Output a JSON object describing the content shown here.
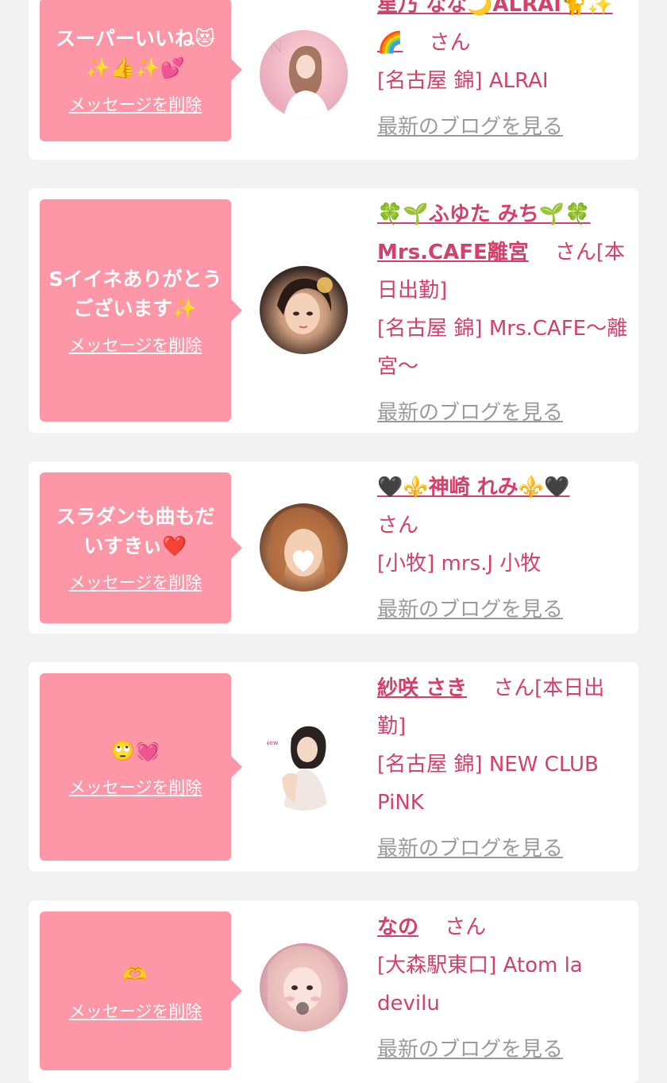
{
  "messages": [
    {
      "bubble": "スーパーいいね😻✨👍✨💕",
      "delete": "メッセージを削除",
      "name": "星乃 なな🌙ALRAI🐈✨🌈",
      "honorific": "さん",
      "status": "",
      "shop": "[名古屋 錦] ALRAI",
      "blog": "最新のブログを見る"
    },
    {
      "bubble": "Sイイネありがとうございます✨",
      "delete": "メッセージを削除",
      "name": "🍀🌱ふゆた みち🌱🍀Mrs.CAFE離宮",
      "honorific": "さん",
      "status": "[本日出勤]",
      "shop": "[名古屋 錦] Mrs.CAFE～離宮～",
      "blog": "最新のブログを見る"
    },
    {
      "bubble": "スラダンも曲もだいすきぃ❤️",
      "delete": "メッセージを削除",
      "name": "🖤⚜️神崎 れみ⚜️🖤",
      "honorific": "さん",
      "status": "",
      "shop": "[小牧] mrs.J 小牧",
      "blog": "最新のブログを見る"
    },
    {
      "bubble": "🙄💓",
      "delete": "メッセージを削除",
      "name": "紗咲 さき",
      "honorific": "さん",
      "status": "[本日出勤]",
      "shop": "[名古屋 錦] NEW CLUB PiNK",
      "blog": "最新のブログを見る"
    },
    {
      "bubble": "🫶",
      "delete": "メッセージを削除",
      "name": "なの",
      "honorific": "さん",
      "status": "",
      "shop": "[大森駅東口] Atom la devilu",
      "blog": "最新のブログを見る"
    }
  ],
  "colors": {
    "accent": "#d5406a",
    "bubble": "#fd96a6",
    "muted": "#9a9a9a",
    "background": "#f2f2f2"
  }
}
